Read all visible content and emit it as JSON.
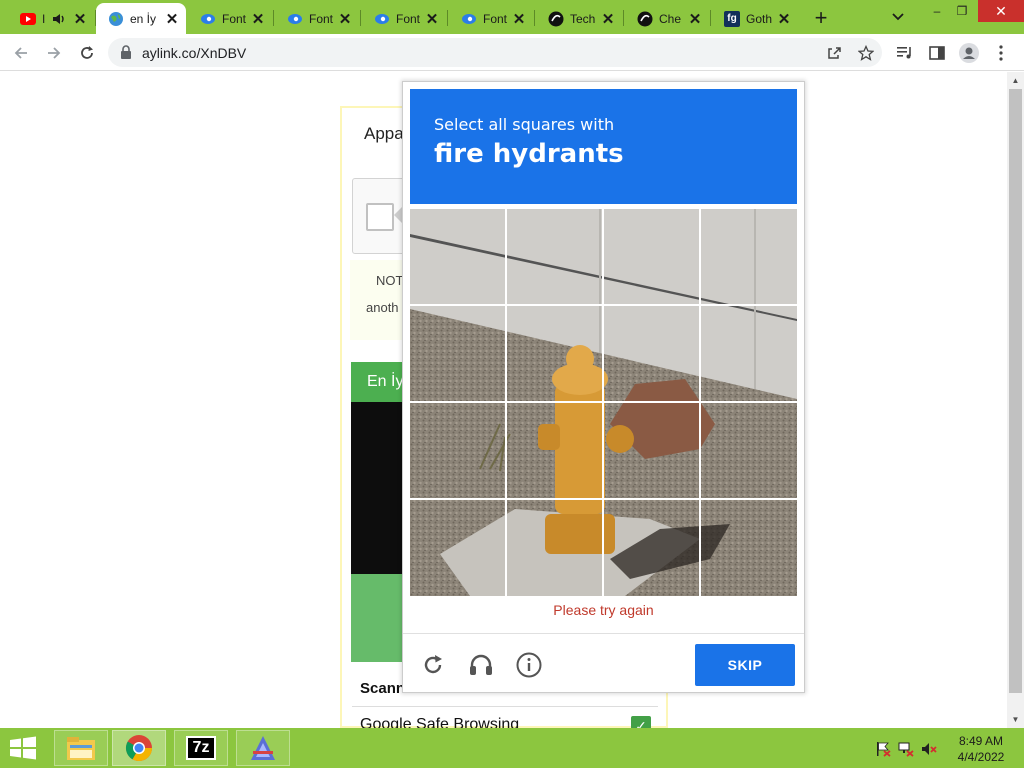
{
  "browser": {
    "tabs": [
      {
        "title": "I",
        "favicon": "youtube-icon",
        "audio": true,
        "active": false
      },
      {
        "title": "en İy",
        "favicon": "globe-icon",
        "active": true
      },
      {
        "title": "Font",
        "favicon": "font-site-icon",
        "active": false
      },
      {
        "title": "Font",
        "favicon": "font-site-icon",
        "active": false
      },
      {
        "title": "Font",
        "favicon": "font-site-icon",
        "active": false
      },
      {
        "title": "Font",
        "favicon": "font-site-icon",
        "active": false
      },
      {
        "title": "Tech",
        "favicon": "chatgpt-icon",
        "active": false
      },
      {
        "title": "Che",
        "favicon": "chatgpt-icon",
        "active": false
      },
      {
        "title": "Goth",
        "favicon": "fg-icon",
        "favicon_text": "fg",
        "active": false
      }
    ],
    "close_glyph": "✕",
    "new_tab_glyph": "+",
    "url": "aylink.co/XnDBV",
    "window": {
      "minimize": "–",
      "restore": "❐",
      "close": "✕"
    }
  },
  "page": {
    "heading_fragment": "Appa",
    "notice_line1": "NOT",
    "notice_line2": "anoth",
    "green_heading": "En İy",
    "scanning_label": "Scann",
    "safe_browsing_label": "Google Safe Browsing",
    "safe_browsing_check": "✓"
  },
  "captcha": {
    "instruction": "Select all squares with",
    "target": "fire hydrants",
    "error": "Please try again",
    "skip_label": "SKIP",
    "grid": {
      "rows": 4,
      "cols": 4
    },
    "footer_icons": [
      "reload-icon",
      "audio-challenge-icon",
      "info-icon"
    ]
  },
  "taskbar": {
    "apps": [
      "file-explorer-icon",
      "chrome-icon",
      "7zip-icon",
      "app-icon"
    ],
    "app_7zip_text": "7z",
    "time": "8:49 AM",
    "date": "4/4/2022"
  }
}
